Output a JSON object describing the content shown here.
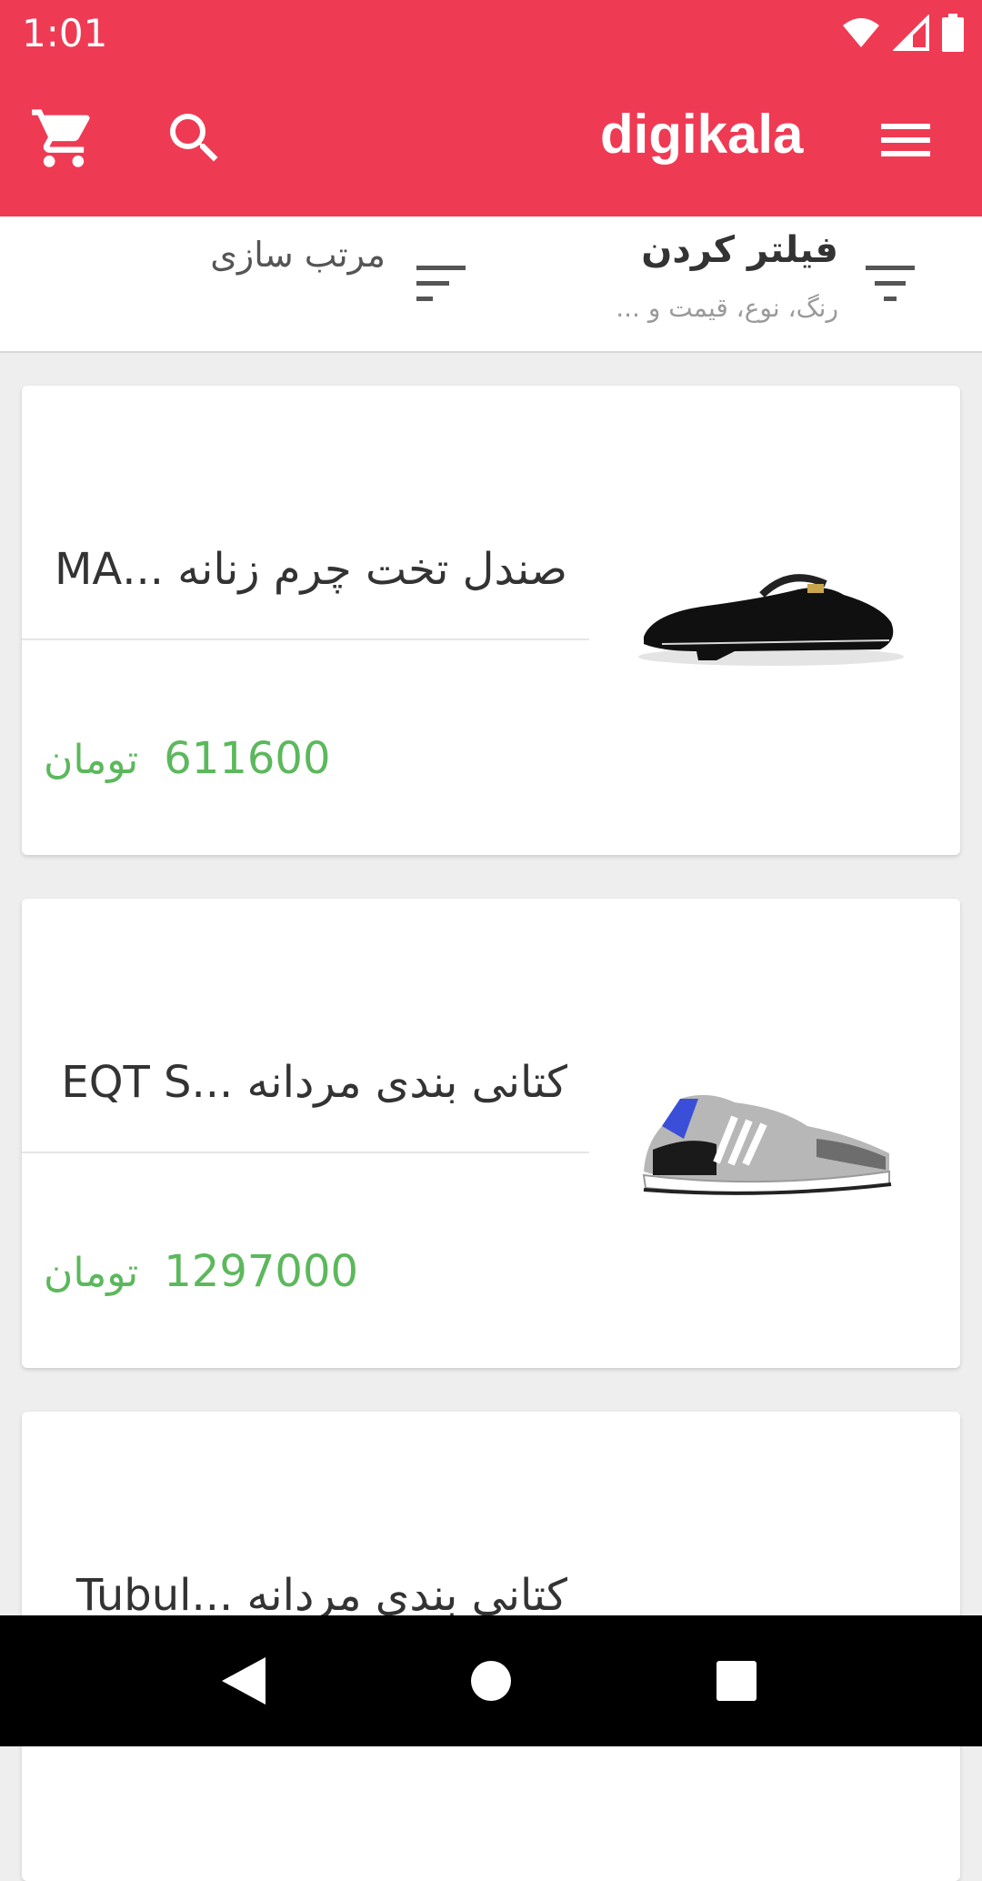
{
  "status_bar": {
    "time": "1:01",
    "icons": [
      "wifi-icon",
      "signal-icon",
      "battery-icon"
    ]
  },
  "app_bar": {
    "logo_text": "digikala",
    "icons": [
      "cart-icon",
      "search-icon",
      "menu-icon"
    ],
    "color": "#ef3a54"
  },
  "filter_bar": {
    "filter_title": "فیلتر کردن",
    "filter_subtitle": "رنگ، نوع، قیمت و ...",
    "sort_title": "مرتب سازی"
  },
  "products": [
    {
      "title": "صندل تخت چرم زنانه ...MA",
      "price": "611600",
      "currency": "تومان"
    },
    {
      "title": "کتانی بندی مردانه ...EQT S",
      "price": "1297000",
      "currency": "تومان"
    },
    {
      "title": "کتانی بندی مردانه ...Tubul",
      "price": "",
      "currency": ""
    }
  ],
  "colors": {
    "accent": "#ef3a54",
    "price": "#5cb85c",
    "background": "#eeeeee"
  },
  "nav_bar": {
    "icons": [
      "back-icon",
      "home-icon",
      "recents-icon"
    ]
  }
}
